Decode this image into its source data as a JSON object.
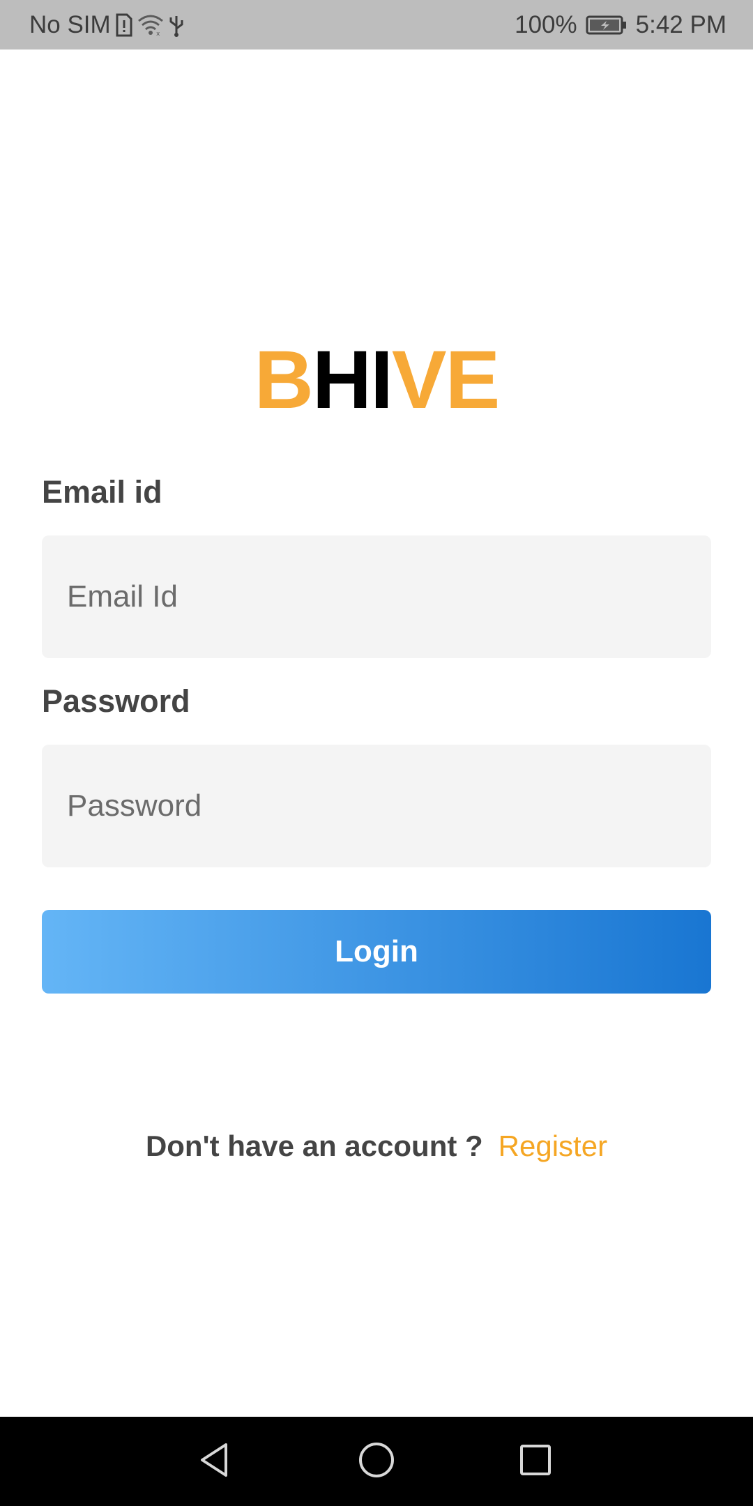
{
  "status_bar": {
    "carrier": "No SIM",
    "battery": "100%",
    "time": "5:42 PM",
    "icons": [
      "sim-alert-icon",
      "wifi-icon",
      "usb-icon",
      "battery-charging-icon"
    ]
  },
  "logo": {
    "letters": [
      {
        "char": "B",
        "color": "#f7a937"
      },
      {
        "char": "H",
        "color": "#000000"
      },
      {
        "char": "I",
        "color": "#000000"
      },
      {
        "char": "V",
        "color": "#f7a937"
      },
      {
        "char": "E",
        "color": "#f7a937"
      }
    ]
  },
  "form": {
    "email_label": "Email id",
    "email_placeholder": "Email Id",
    "email_value": "",
    "password_label": "Password",
    "password_placeholder": "Password",
    "password_value": "",
    "login_label": "Login"
  },
  "register": {
    "prompt": "Don't have an account ?",
    "link": "Register"
  },
  "colors": {
    "accent": "#f5a623",
    "button_gradient_start": "#64b5f6",
    "button_gradient_end": "#1976d2",
    "input_bg": "#f4f4f4",
    "status_bar_bg": "#bdbdbd"
  },
  "nav_bar": {
    "icons": [
      "back-icon",
      "home-icon",
      "recents-icon"
    ]
  }
}
